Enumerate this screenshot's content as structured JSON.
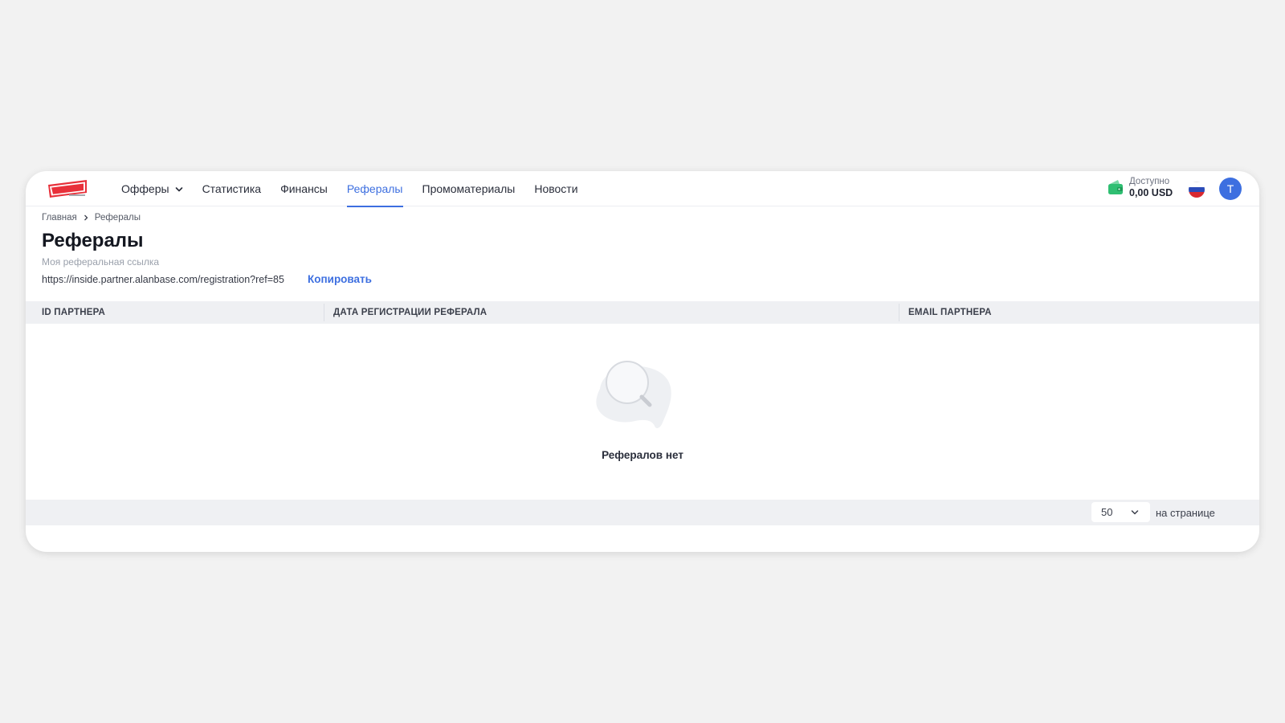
{
  "header": {
    "nav": [
      {
        "label": "Офферы",
        "dropdown": true,
        "active": false
      },
      {
        "label": "Статистика",
        "active": false
      },
      {
        "label": "Финансы",
        "active": false
      },
      {
        "label": "Рефералы",
        "active": true
      },
      {
        "label": "Промоматериалы",
        "active": false
      },
      {
        "label": "Новости",
        "active": false
      }
    ],
    "balance_label": "Доступно",
    "balance_value": "0,00 USD",
    "language": "ru",
    "avatar_initial": "T",
    "accent_color": "#3d6fe0"
  },
  "breadcrumb": {
    "home": "Главная",
    "current": "Рефералы"
  },
  "page": {
    "title": "Рефералы",
    "ref_label": "Моя реферальная ссылка",
    "ref_link": "https://inside.partner.alanbase.com/registration?ref=85",
    "copy_label": "Копировать"
  },
  "table": {
    "columns": [
      "ID ПАРТНЕРА",
      "ДАТА РЕГИСТРАЦИИ РЕФЕРАЛА",
      "EMAIL ПАРТНЕРА"
    ],
    "rows": [],
    "empty_text": "Рефералов нет"
  },
  "pagination": {
    "per_page": "50",
    "per_page_label": "на странице"
  }
}
